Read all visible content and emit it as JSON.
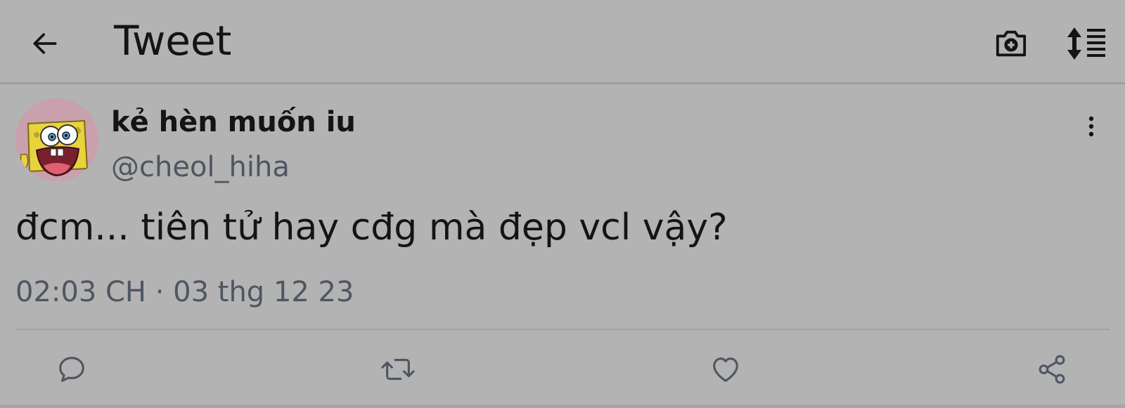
{
  "header": {
    "title": "Tweet",
    "back_icon": "arrow-left-icon",
    "camera_icon": "camera-plus-icon",
    "sort_icon": "sort-list-icon"
  },
  "tweet": {
    "display_name": "kẻ hèn muốn iu",
    "handle": "@cheol_hiha",
    "text": "đcm... tiên tử hay cđg mà đẹp vcl vậy?",
    "timestamp": "02:03 CH · 03 thg 12 23"
  },
  "actions": [
    {
      "name": "reply",
      "icon": "reply-icon"
    },
    {
      "name": "retweet",
      "icon": "retweet-icon"
    },
    {
      "name": "like",
      "icon": "heart-icon"
    },
    {
      "name": "share",
      "icon": "share-icon"
    }
  ],
  "colors": {
    "background": "#b3b3b3",
    "text": "#141414",
    "secondary_text": "#4e5660",
    "divider": "#a2a2a2"
  }
}
